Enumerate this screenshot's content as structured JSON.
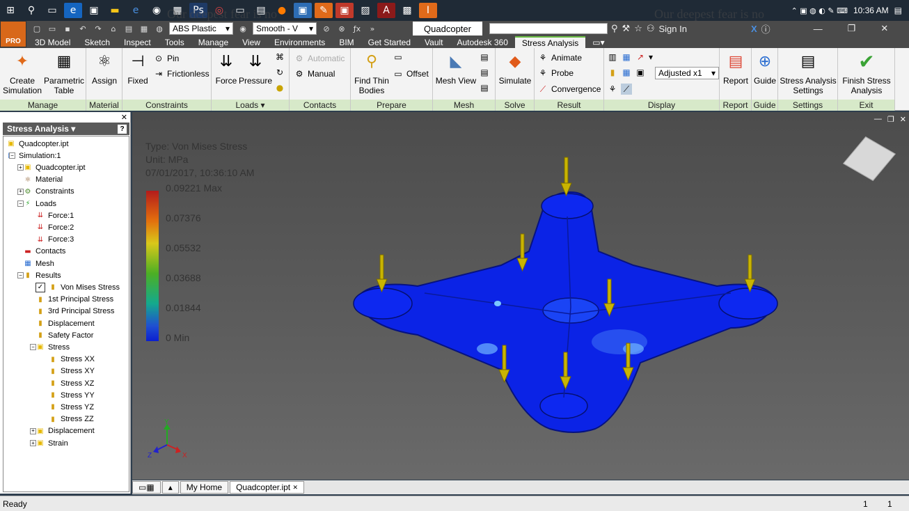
{
  "taskbar": {
    "time": "10:36 AM",
    "ghost_text": "Our deepest fear is no",
    "ghost_text2": "Our deepest fear is no"
  },
  "quick_access": {
    "material": "ABS Plastic",
    "appearance": "Smooth - V",
    "document": "Quadcopter",
    "search_placeholder": "",
    "sign_in": "Sign In"
  },
  "logo": {
    "label": "PRO"
  },
  "tabs": [
    "3D Model",
    "Sketch",
    "Inspect",
    "Tools",
    "Manage",
    "View",
    "Environments",
    "BIM",
    "Get Started",
    "Vault",
    "Autodesk 360",
    "Stress Analysis"
  ],
  "active_tab": "Stress Analysis",
  "ribbon": {
    "manage": {
      "title": "Manage",
      "create": "Create Simulation",
      "param": "Parametric Table"
    },
    "material": {
      "title": "Material",
      "assign": "Assign"
    },
    "constraints": {
      "title": "Constraints",
      "fixed": "Fixed",
      "pin": "Pin",
      "frictionless": "Frictionless"
    },
    "loads": {
      "title": "Loads",
      "force": "Force",
      "pressure": "Pressure"
    },
    "contacts": {
      "title": "Contacts",
      "automatic": "Automatic",
      "manual": "Manual"
    },
    "prepare": {
      "title": "Prepare",
      "find_thin": "Find Thin Bodies",
      "offset": "Offset"
    },
    "mesh": {
      "title": "Mesh",
      "mesh_view": "Mesh View"
    },
    "solve": {
      "title": "Solve",
      "simulate": "Simulate"
    },
    "result": {
      "title": "Result",
      "animate": "Animate",
      "probe": "Probe",
      "convergence": "Convergence"
    },
    "display": {
      "title": "Display",
      "adjusted": "Adjusted x1"
    },
    "report": {
      "title": "Report",
      "report": "Report"
    },
    "guide": {
      "title": "Guide",
      "guide": "Guide"
    },
    "settings": {
      "title": "Settings",
      "settings": "Stress Analysis Settings"
    },
    "exit": {
      "title": "Exit",
      "finish": "Finish Stress Analysis"
    }
  },
  "browser": {
    "header": "Stress Analysis ▾",
    "tree": [
      {
        "label": "Quadcopter.ipt",
        "level": 0,
        "icon": "part-icon"
      },
      {
        "label": "Simulation:1",
        "level": 0,
        "icon": "simulation-icon"
      },
      {
        "label": "Quadcopter.ipt",
        "level": 1,
        "icon": "part-icon"
      },
      {
        "label": "Material",
        "level": 1,
        "icon": "material-icon"
      },
      {
        "label": "Constraints",
        "level": 1,
        "icon": "constraint-icon"
      },
      {
        "label": "Loads",
        "level": 1,
        "icon": "loads-icon"
      },
      {
        "label": "Force:1",
        "level": 2,
        "icon": "force-icon"
      },
      {
        "label": "Force:2",
        "level": 2,
        "icon": "force-icon"
      },
      {
        "label": "Force:3",
        "level": 2,
        "icon": "force-icon"
      },
      {
        "label": "Contacts",
        "level": 1,
        "icon": "contacts-icon"
      },
      {
        "label": "Mesh",
        "level": 1,
        "icon": "mesh-icon"
      },
      {
        "label": "Results",
        "level": 1,
        "icon": "results-icon"
      },
      {
        "label": "Von Mises Stress",
        "level": 2,
        "icon": "stress-icon"
      },
      {
        "label": "1st Principal Stress",
        "level": 2,
        "icon": "stress-icon"
      },
      {
        "label": "3rd Principal Stress",
        "level": 2,
        "icon": "stress-icon"
      },
      {
        "label": "Displacement",
        "level": 2,
        "icon": "stress-icon"
      },
      {
        "label": "Safety Factor",
        "level": 2,
        "icon": "stress-icon"
      },
      {
        "label": "Stress",
        "level": 2,
        "icon": "folder-icon"
      },
      {
        "label": "Stress XX",
        "level": 3,
        "icon": "stress-icon"
      },
      {
        "label": "Stress XY",
        "level": 3,
        "icon": "stress-icon"
      },
      {
        "label": "Stress XZ",
        "level": 3,
        "icon": "stress-icon"
      },
      {
        "label": "Stress YY",
        "level": 3,
        "icon": "stress-icon"
      },
      {
        "label": "Stress YZ",
        "level": 3,
        "icon": "stress-icon"
      },
      {
        "label": "Stress ZZ",
        "level": 3,
        "icon": "stress-icon"
      },
      {
        "label": "Displacement",
        "level": 2,
        "icon": "folder-icon"
      },
      {
        "label": "Strain",
        "level": 2,
        "icon": "folder-icon"
      }
    ]
  },
  "viewport": {
    "type": "Type: Von Mises Stress",
    "unit": "Unit: MPa",
    "date": "07/01/2017, 10:36:10 AM",
    "legend": [
      "0.09221 Max",
      "0.07376",
      "0.05532",
      "0.03688",
      "0.01844",
      "0 Min"
    ],
    "axis": {
      "x": "X",
      "y": "Y",
      "z": "Z"
    }
  },
  "doc_tabs": {
    "home": "My Home",
    "file": "Quadcopter.ipt"
  },
  "status": {
    "text": "Ready",
    "n1": "1",
    "n2": "1"
  }
}
